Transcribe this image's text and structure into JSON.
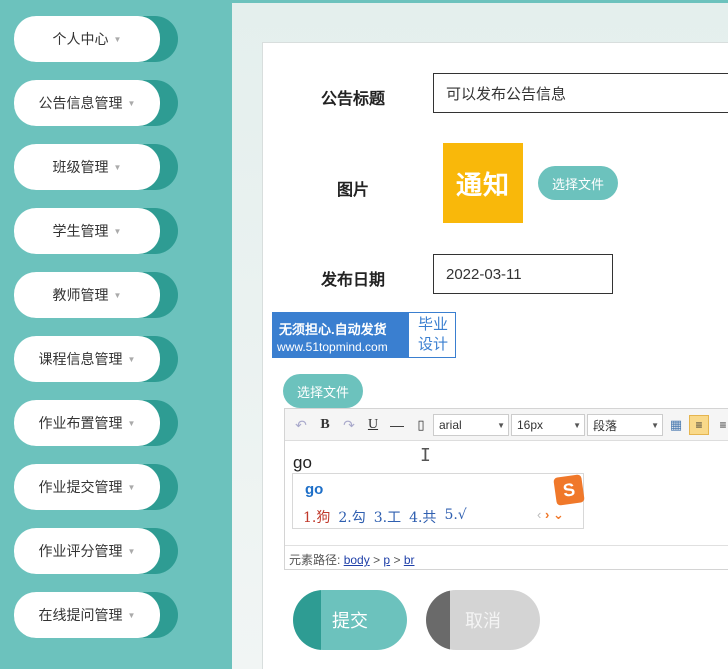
{
  "sidebar": {
    "items": [
      {
        "label": "个人中心"
      },
      {
        "label": "公告信息管理"
      },
      {
        "label": "班级管理"
      },
      {
        "label": "学生管理"
      },
      {
        "label": "教师管理"
      },
      {
        "label": "课程信息管理"
      },
      {
        "label": "作业布置管理"
      },
      {
        "label": "作业提交管理"
      },
      {
        "label": "作业评分管理"
      },
      {
        "label": "在线提问管理"
      }
    ],
    "caret": "▼"
  },
  "form": {
    "title_label": "公告标题",
    "title_value": "可以发布公告信息",
    "image_label": "图片",
    "image_thumb_text": "通知",
    "choose_file": "选择文件",
    "date_label": "发布日期",
    "date_value": "2022-03-11",
    "choose_file_2": "选择文件"
  },
  "promo": {
    "line1": "无须担心.自动发货",
    "line2": "www.51topmind.com",
    "side1": "毕业",
    "side2": "设计"
  },
  "editor": {
    "toolbar": {
      "bold": "B",
      "underline": "U",
      "font_family": "arial",
      "font_size": "16px",
      "paragraph": "段落"
    },
    "content": "go",
    "ime": {
      "composition": "go",
      "candidates": [
        "1.狗",
        "2.勾",
        "3.工",
        "4.共",
        "5.√"
      ],
      "logo": "S"
    },
    "path": {
      "label": "元素路径:",
      "body": "body",
      "p": "p",
      "br": "br",
      "sep": ">"
    }
  },
  "buttons": {
    "submit": "提交",
    "cancel": "取消"
  },
  "colors": {
    "teal": "#6cc2bd",
    "teal_dark": "#2e9c93",
    "notice_yellow": "#f9b80a",
    "promo_blue": "#3a7fd0"
  }
}
